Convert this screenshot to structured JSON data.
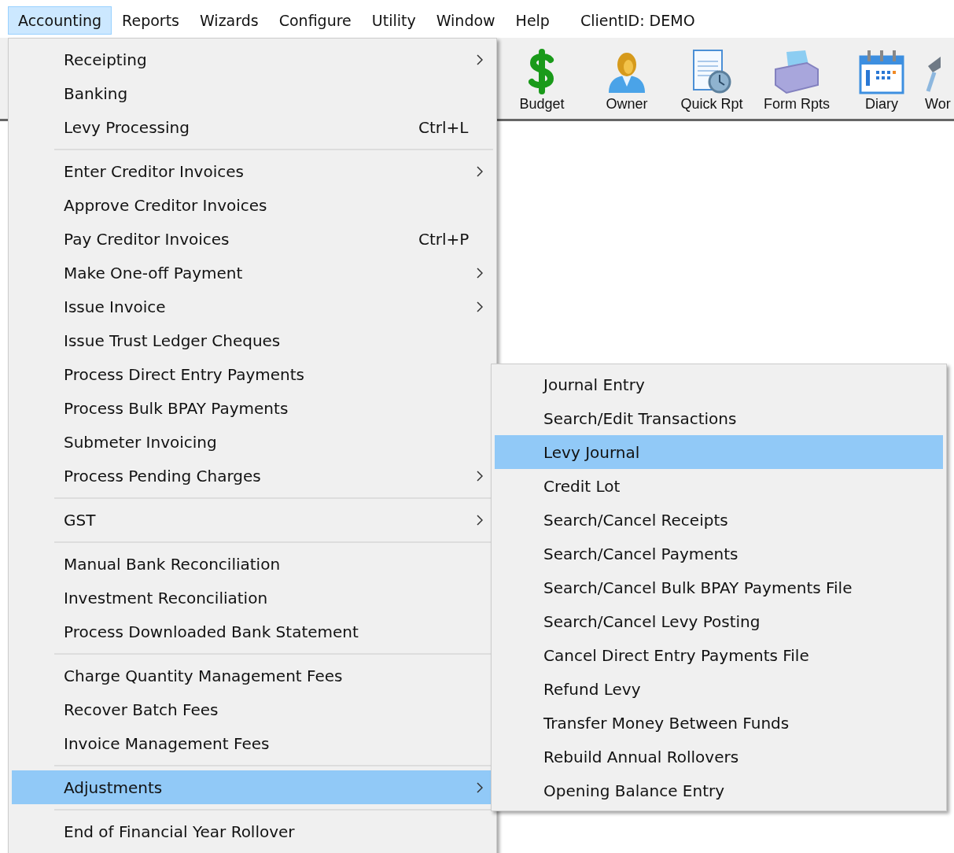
{
  "menubar": {
    "items": [
      {
        "label": "Accounting",
        "selected": true
      },
      {
        "label": "Reports",
        "selected": false
      },
      {
        "label": "Wizards",
        "selected": false
      },
      {
        "label": "Configure",
        "selected": false
      },
      {
        "label": "Utility",
        "selected": false
      },
      {
        "label": "Window",
        "selected": false
      },
      {
        "label": "Help",
        "selected": false
      }
    ],
    "client_id": "ClientID: DEMO"
  },
  "toolbar": {
    "buttons": [
      {
        "kind": "dollar",
        "label": "Budget"
      },
      {
        "kind": "owner",
        "label": "Owner"
      },
      {
        "kind": "report",
        "label": "Quick Rpt"
      },
      {
        "kind": "printer",
        "label": "Form Rpts"
      },
      {
        "kind": "calendar",
        "label": "Diary"
      },
      {
        "kind": "tool",
        "label": "Wor"
      }
    ]
  },
  "accounting_menu": {
    "items": [
      {
        "kind": "item",
        "label": "Receipting",
        "submenu": true,
        "selected": false
      },
      {
        "kind": "item",
        "label": "Banking",
        "submenu": false,
        "selected": false
      },
      {
        "kind": "item",
        "label": "Levy Processing",
        "shortcut": "Ctrl+L",
        "submenu": false,
        "selected": false
      },
      {
        "kind": "separator"
      },
      {
        "kind": "item",
        "label": "Enter Creditor Invoices",
        "submenu": true,
        "selected": false
      },
      {
        "kind": "item",
        "label": "Approve Creditor Invoices",
        "submenu": false,
        "selected": false
      },
      {
        "kind": "item",
        "label": "Pay Creditor Invoices",
        "shortcut": "Ctrl+P",
        "submenu": false,
        "selected": false
      },
      {
        "kind": "item",
        "label": "Make One-off Payment",
        "submenu": true,
        "selected": false
      },
      {
        "kind": "item",
        "label": "Issue Invoice",
        "submenu": true,
        "selected": false
      },
      {
        "kind": "item",
        "label": "Issue Trust Ledger Cheques",
        "submenu": false,
        "selected": false
      },
      {
        "kind": "item",
        "label": "Process Direct Entry Payments",
        "submenu": false,
        "selected": false
      },
      {
        "kind": "item",
        "label": "Process Bulk BPAY Payments",
        "submenu": false,
        "selected": false
      },
      {
        "kind": "item",
        "label": "Submeter Invoicing",
        "submenu": false,
        "selected": false
      },
      {
        "kind": "item",
        "label": "Process Pending Charges",
        "submenu": true,
        "selected": false
      },
      {
        "kind": "separator"
      },
      {
        "kind": "item",
        "label": "GST",
        "submenu": true,
        "selected": false
      },
      {
        "kind": "separator"
      },
      {
        "kind": "item",
        "label": "Manual Bank Reconciliation",
        "submenu": false,
        "selected": false
      },
      {
        "kind": "item",
        "label": "Investment Reconciliation",
        "submenu": false,
        "selected": false
      },
      {
        "kind": "item",
        "label": "Process Downloaded Bank Statement",
        "submenu": false,
        "selected": false
      },
      {
        "kind": "separator"
      },
      {
        "kind": "item",
        "label": "Charge Quantity Management Fees",
        "submenu": false,
        "selected": false
      },
      {
        "kind": "item",
        "label": "Recover Batch Fees",
        "submenu": false,
        "selected": false
      },
      {
        "kind": "item",
        "label": "Invoice Management Fees",
        "submenu": false,
        "selected": false
      },
      {
        "kind": "separator"
      },
      {
        "kind": "item",
        "label": "Adjustments",
        "submenu": true,
        "selected": true
      },
      {
        "kind": "separator"
      },
      {
        "kind": "item",
        "label": "End of Financial Year Rollover",
        "submenu": false,
        "selected": false
      }
    ]
  },
  "adjustments_menu": {
    "items": [
      {
        "label": "Journal Entry",
        "selected": false
      },
      {
        "label": "Search/Edit Transactions",
        "selected": false
      },
      {
        "label": "Levy Journal",
        "selected": true
      },
      {
        "label": "Credit Lot",
        "selected": false
      },
      {
        "label": "Search/Cancel Receipts",
        "selected": false
      },
      {
        "label": "Search/Cancel Payments",
        "selected": false
      },
      {
        "label": "Search/Cancel Bulk BPAY Payments File",
        "selected": false
      },
      {
        "label": "Search/Cancel Levy Posting",
        "selected": false
      },
      {
        "label": "Cancel Direct Entry Payments File",
        "selected": false
      },
      {
        "label": "Refund Levy",
        "selected": false
      },
      {
        "label": "Transfer Money Between Funds",
        "selected": false
      },
      {
        "label": "Rebuild Annual Rollovers",
        "selected": false
      },
      {
        "label": "Opening Balance Entry",
        "selected": false
      }
    ]
  }
}
